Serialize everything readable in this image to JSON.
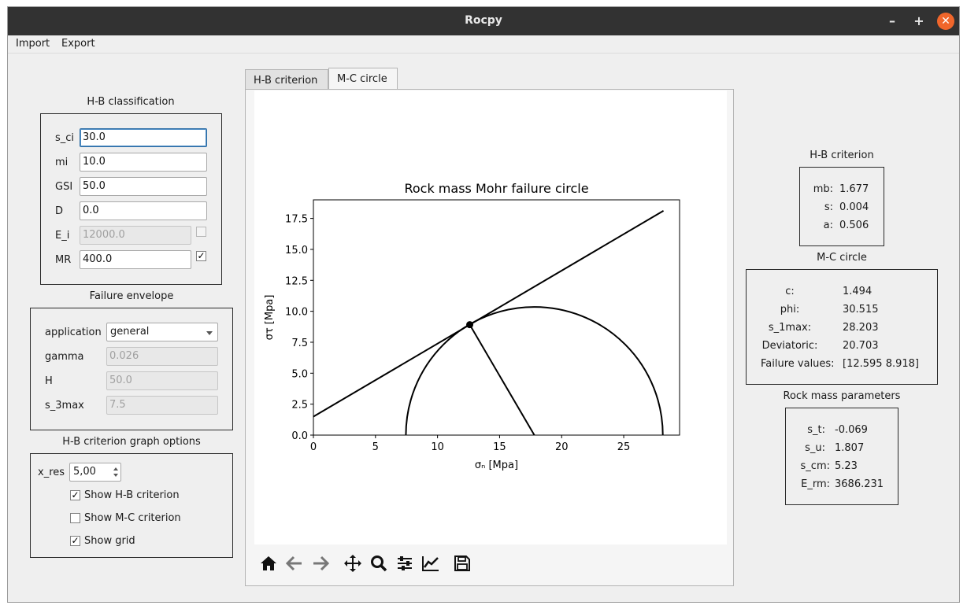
{
  "window": {
    "title": "Rocpy",
    "minimize": "–",
    "maximize": "+",
    "close": "✕"
  },
  "menu": {
    "import": "Import",
    "export": "Export"
  },
  "hb_classification": {
    "title": "H-B classification",
    "fields": [
      {
        "label": "s_ci",
        "value": "30.0"
      },
      {
        "label": "mi",
        "value": "10.0"
      },
      {
        "label": "GSI",
        "value": "50.0"
      },
      {
        "label": "D",
        "value": "0.0"
      },
      {
        "label": "E_i",
        "value": "12000.0"
      },
      {
        "label": "MR",
        "value": "400.0"
      }
    ],
    "ei_checked": false,
    "mr_checked": true
  },
  "failure_envelope": {
    "title": "Failure envelope",
    "application_label": "application",
    "application_value": "general",
    "gamma_label": "gamma",
    "gamma_value": "0.026",
    "h_label": "H",
    "h_value": "50.0",
    "s3max_label": "s_3max",
    "s3max_value": "7.5"
  },
  "graph_options": {
    "title": "H-B criterion graph options",
    "xres_label": "x_res",
    "xres_value": "5,00",
    "show_hb": "Show H-B criterion",
    "show_hb_checked": true,
    "show_mc": "Show M-C criterion",
    "show_mc_checked": false,
    "show_grid": "Show grid",
    "show_grid_checked": true
  },
  "tabs": [
    {
      "label": "H-B criterion"
    },
    {
      "label": "M-C circle"
    }
  ],
  "chart_data": {
    "type": "line",
    "title": "Rock mass Mohr failure circle",
    "xlabel": "σₙ [Mpa]",
    "ylabel": "στ [Mpa]",
    "xlim": [
      0,
      29.5
    ],
    "ylim": [
      0,
      19
    ],
    "xticks": [
      "0",
      "5",
      "10",
      "15",
      "20",
      "25"
    ],
    "yticks": [
      "0.0",
      "2.5",
      "5.0",
      "7.5",
      "10.0",
      "12.5",
      "15.0",
      "17.5"
    ],
    "grid": false,
    "circle": {
      "center": 17.8,
      "radius": 10.35
    },
    "envelope_line": {
      "x": [
        0,
        28.203
      ],
      "y": [
        1.494,
        18.12
      ]
    },
    "radius_line": {
      "x": [
        12.595,
        17.8
      ],
      "y": [
        8.918,
        0
      ]
    },
    "tangent_point": {
      "x": 12.595,
      "y": 8.918
    }
  },
  "toolbar": {
    "icons": [
      "home-icon",
      "back-arrow-icon",
      "forward-arrow-icon",
      "pan-icon",
      "zoom-icon",
      "configure-subplots-icon",
      "edit-axis-icon",
      "save-icon"
    ]
  },
  "hb_criterion": {
    "title": "H-B criterion",
    "rows": [
      {
        "k": "mb:",
        "v": "1.677"
      },
      {
        "k": "s:",
        "v": "0.004"
      },
      {
        "k": "a:",
        "v": "0.506"
      }
    ]
  },
  "mc_circle": {
    "title": "M-C circle",
    "rows": [
      {
        "k": "c:",
        "v": "1.494"
      },
      {
        "k": "phi:",
        "v": "30.515"
      },
      {
        "k": "s_1max:",
        "v": "28.203"
      },
      {
        "k": "Deviatoric:",
        "v": "20.703"
      },
      {
        "k": "Failure values:",
        "v": "[12.595  8.918]"
      }
    ]
  },
  "rock_mass": {
    "title": "Rock mass parameters",
    "rows": [
      {
        "k": "s_t:",
        "v": "-0.069"
      },
      {
        "k": "s_u:",
        "v": "1.807"
      },
      {
        "k": "s_cm:",
        "v": "5.23"
      },
      {
        "k": "E_rm:",
        "v": "3686.231"
      }
    ]
  }
}
